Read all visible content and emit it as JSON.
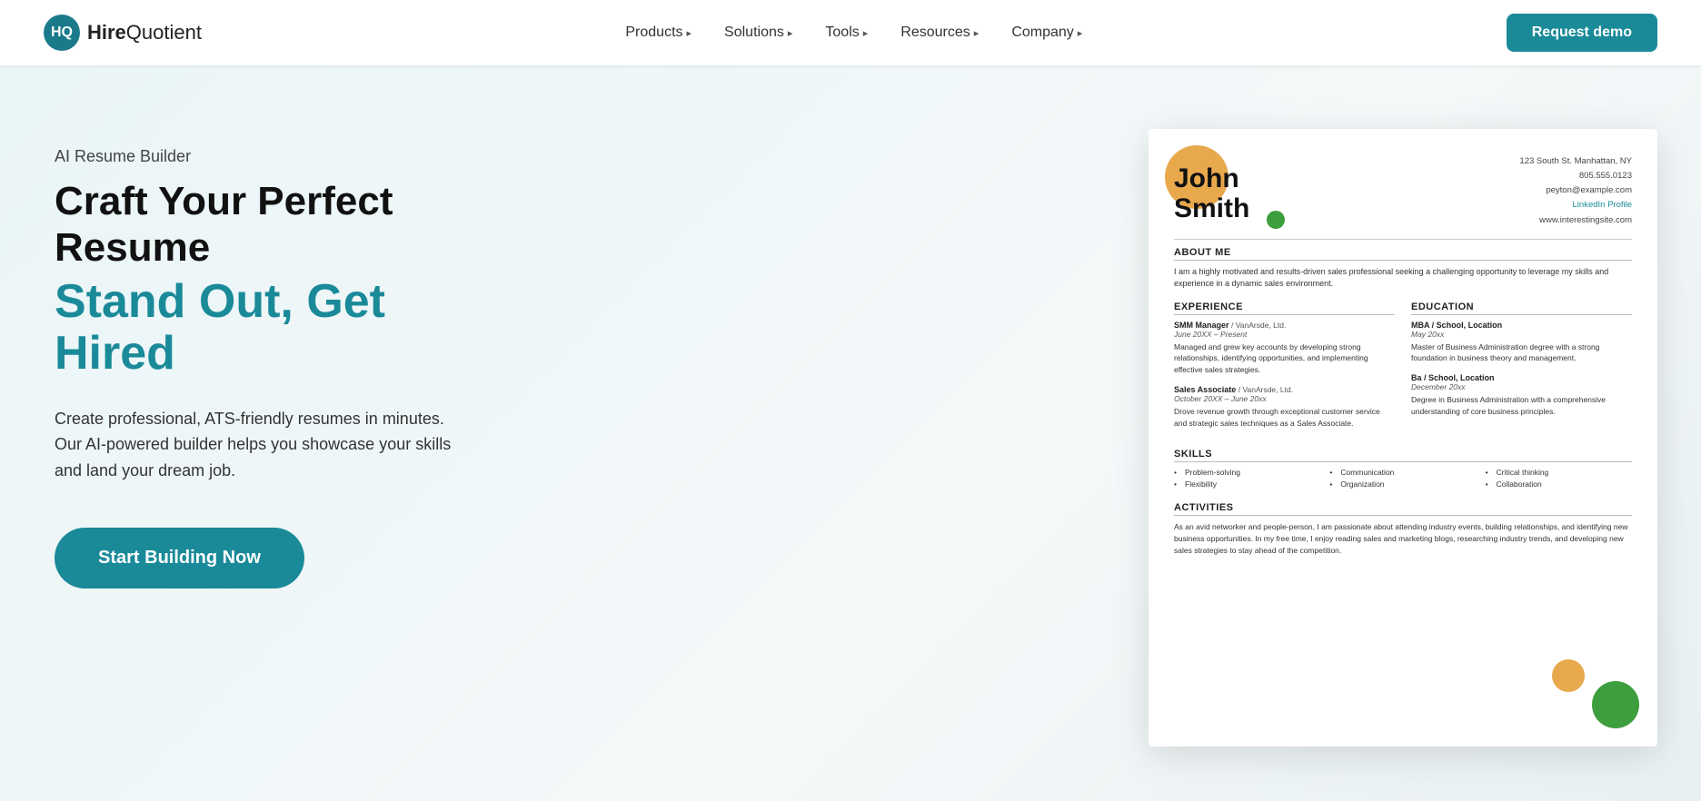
{
  "nav": {
    "logo_icon": "HQ",
    "logo_bold": "Hire",
    "logo_light": "Quotient",
    "items": [
      {
        "label": "Products",
        "has_arrow": true
      },
      {
        "label": "Solutions",
        "has_arrow": true
      },
      {
        "label": "Tools",
        "has_arrow": true
      },
      {
        "label": "Resources",
        "has_arrow": true
      },
      {
        "label": "Company",
        "has_arrow": true
      }
    ],
    "cta_label": "Request demo"
  },
  "hero": {
    "tag": "AI Resume Builder",
    "title": "Craft Your Perfect Resume",
    "subtitle_line1": "Stand Out, Get",
    "subtitle_line2": "Hired",
    "description": "Create professional, ATS-friendly resumes in minutes. Our AI-powered builder helps you showcase your skills and land your dream job.",
    "cta_label": "Start Building Now"
  },
  "resume": {
    "name": "John\nSmith",
    "contact": {
      "address": "123 South St. Manhattan, NY",
      "phone": "805.555.0123",
      "email": "peyton@example.com",
      "linkedin": "LinkedIn Profile",
      "website": "www.interestingsite.com"
    },
    "about_title": "About Me",
    "about_text": "I am a highly motivated and results-driven sales professional seeking a challenging opportunity to leverage my skills and experience in a dynamic sales environment.",
    "experience_title": "Experience",
    "education_title": "Education",
    "jobs": [
      {
        "title": "SMM Manager",
        "company": "/ VanArsde, Ltd.",
        "date": "June 20XX – Present",
        "desc": "Managed and grew key accounts by developing strong relationships, identifying opportunities, and implementing effective sales strategies."
      },
      {
        "title": "Sales Associate",
        "company": "/ VanArsde, Ltd.",
        "date": "October 20XX – June 20xx",
        "desc": "Drove revenue growth through exceptional customer service and strategic sales techniques as a Sales Associate."
      }
    ],
    "education": [
      {
        "degree": "MBA / School, Location",
        "date": "May 20xx",
        "desc": "Master of Business Administration degree with a strong foundation in business theory and management."
      },
      {
        "degree": "Ba / School, Location",
        "date": "December 20xx",
        "desc": "Degree in Business Administration with a comprehensive understanding of core business principles."
      }
    ],
    "skills_title": "Skills",
    "skills_col1": [
      "Problem-solving",
      "Flexibility"
    ],
    "skills_col2": [
      "Communication",
      "Organization"
    ],
    "skills_col3": [
      "Critical thinking",
      "Collaboration"
    ],
    "activities_title": "Activities",
    "activities_text": "As an avid networker and people-person, I am passionate about attending industry events, building relationships, and identifying new business opportunities. In my free time, I enjoy reading sales and marketing blogs, researching industry trends, and developing new sales strategies to stay ahead of the competition."
  }
}
